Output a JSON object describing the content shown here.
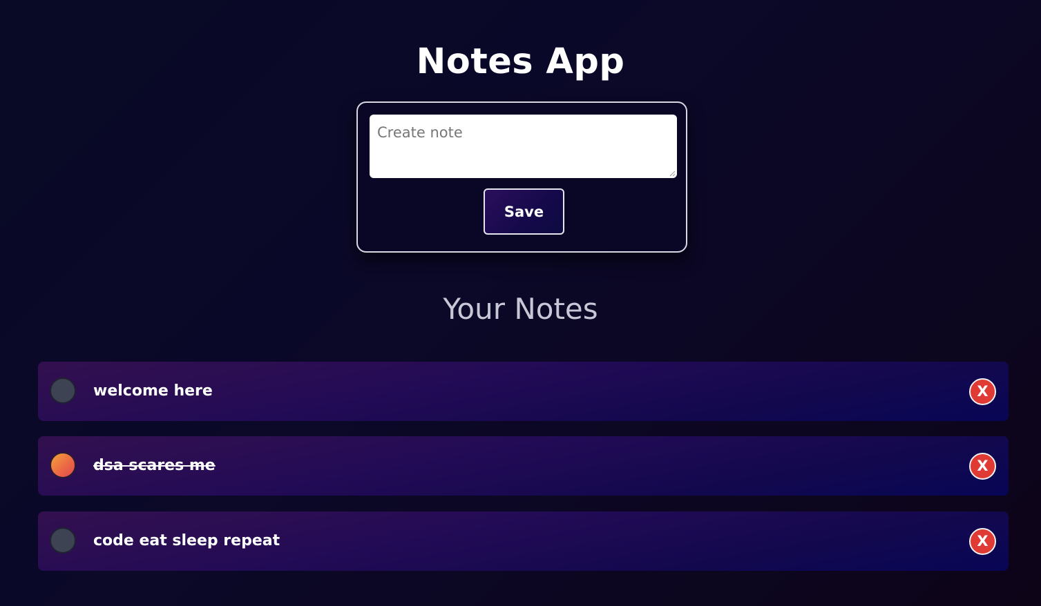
{
  "app": {
    "title": "Notes App"
  },
  "create_form": {
    "input_placeholder": "Create note",
    "input_value": "",
    "save_label": "Save"
  },
  "notes_section": {
    "title": "Your Notes"
  },
  "notes": [
    {
      "text": "welcome here",
      "done": false,
      "delete_label": "X"
    },
    {
      "text": "dsa scares me",
      "done": true,
      "delete_label": "X"
    },
    {
      "text": "code eat sleep repeat",
      "done": false,
      "delete_label": "X"
    }
  ],
  "colors": {
    "background": "#0a0826",
    "accent_delete": "#e03a34",
    "done_toggle_gradient_start": "#f2a43a",
    "done_toggle_gradient_end": "#e0494e",
    "pending_toggle": "#3d4353"
  },
  "icons": {
    "toggle_pending": "circle-empty-icon",
    "toggle_done": "circle-filled-icon",
    "delete": "close-icon"
  }
}
